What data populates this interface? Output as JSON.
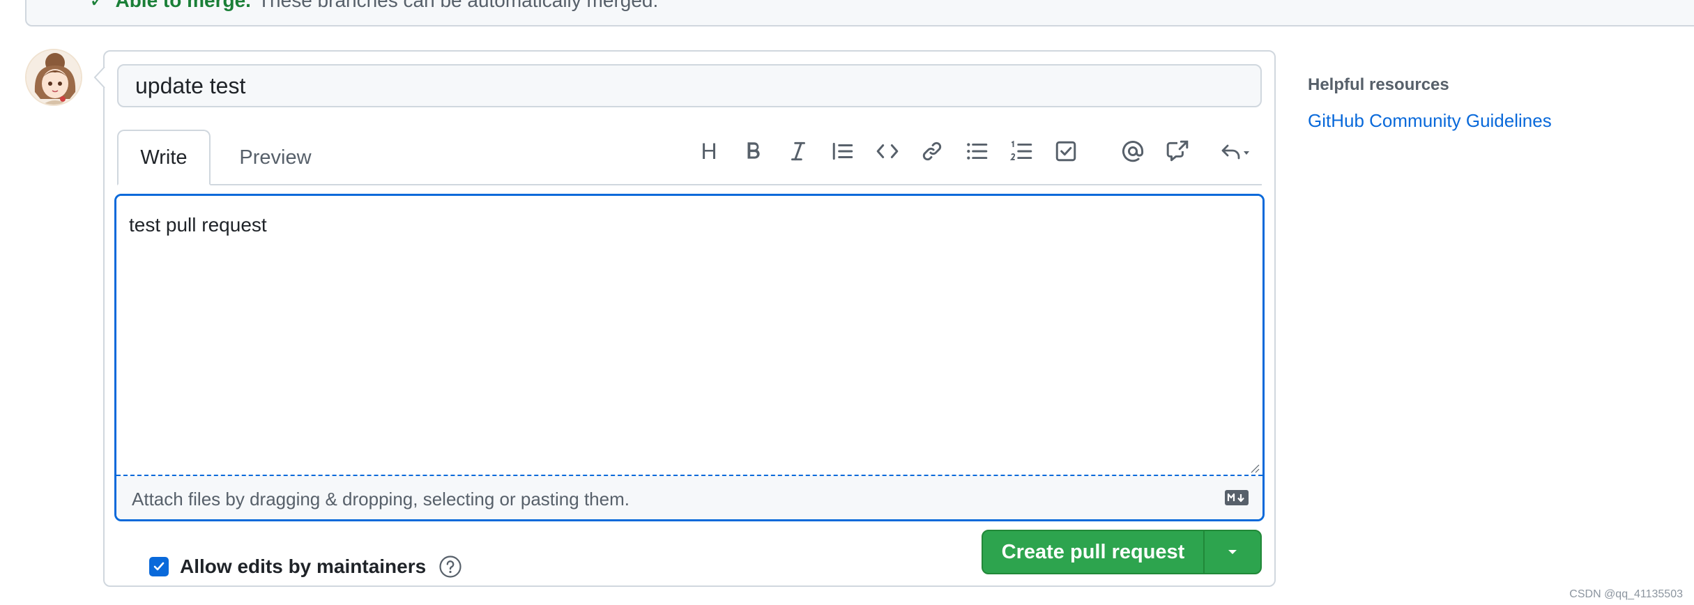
{
  "merge_status": {
    "check_glyph": "✓",
    "label": "Able to merge.",
    "message": "These branches can be automatically merged."
  },
  "title_field": {
    "value": "update test"
  },
  "tabs": [
    {
      "label": "Write",
      "selected": true
    },
    {
      "label": "Preview",
      "selected": false
    }
  ],
  "toolbar": {
    "heading": "H",
    "icons": [
      "heading-icon",
      "bold-icon",
      "italic-icon",
      "quote-icon",
      "code-icon",
      "link-icon",
      "unordered-list-icon",
      "ordered-list-icon",
      "task-list-icon",
      "mention-icon",
      "reference-icon",
      "saved-replies-icon"
    ]
  },
  "body_field": {
    "value": "test pull request"
  },
  "attach": {
    "text": "Attach files by dragging & dropping, selecting or pasting them."
  },
  "allow_edits": {
    "label": "Allow edits by maintainers",
    "checked": true
  },
  "create_button": {
    "label": "Create pull request"
  },
  "sidebar": {
    "title": "Helpful resources",
    "link": "GitHub Community Guidelines"
  },
  "watermark": "CSDN @qq_41135503",
  "colors": {
    "accent": "#0969da",
    "success": "#2da44e",
    "muted": "#57606a",
    "border": "#d0d7de"
  }
}
